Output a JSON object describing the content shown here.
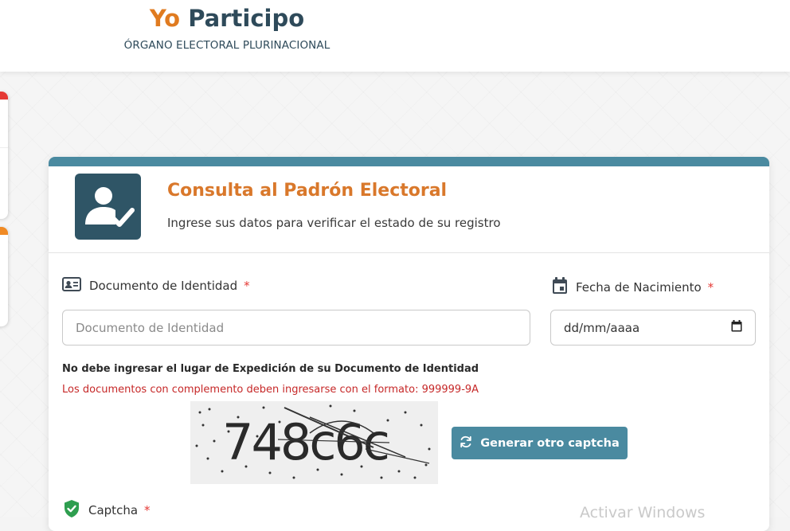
{
  "header": {
    "brand_yo": "Yo",
    "brand_participo": "Participo",
    "subtitle": "ÓRGANO ELECTORAL PLURINACIONAL"
  },
  "card": {
    "title": "Consulta al Padrón Electoral",
    "subtitle": "Ingrese sus datos para verificar el estado de su registro"
  },
  "form": {
    "document": {
      "label": "Documento de Identidad",
      "required_mark": "*",
      "placeholder": "Documento de Identidad",
      "value": ""
    },
    "birthdate": {
      "label": "Fecha de Nacimiento",
      "required_mark": "*",
      "value_display": "dd/mm/aaaa"
    },
    "note_bold": "No debe ingresar el lugar de Expedición de su Documento de Identidad",
    "note_red": "Los documentos con complemento deben ingresarse con el formato: 999999-9A",
    "captcha_image_text": "748c6c",
    "regenerate_button": "Generar otro captcha",
    "captcha_label": "Captcha",
    "captcha_required_mark": "*"
  },
  "watermark": "Activar Windows",
  "colors": {
    "brand_orange": "#e07b20",
    "brand_dark": "#2e4a5a",
    "accent_teal": "#4a8aa0",
    "title_orange": "#d9782b",
    "required_red": "#e53935",
    "note_red": "#c62828",
    "success_green": "#2e9e4f"
  },
  "icons": {
    "avatar": "user-check-icon",
    "document": "id-card-icon",
    "date": "calendar-icon",
    "date_picker": "calendar-picker-icon",
    "refresh": "refresh-icon",
    "captcha": "shield-check-icon"
  }
}
